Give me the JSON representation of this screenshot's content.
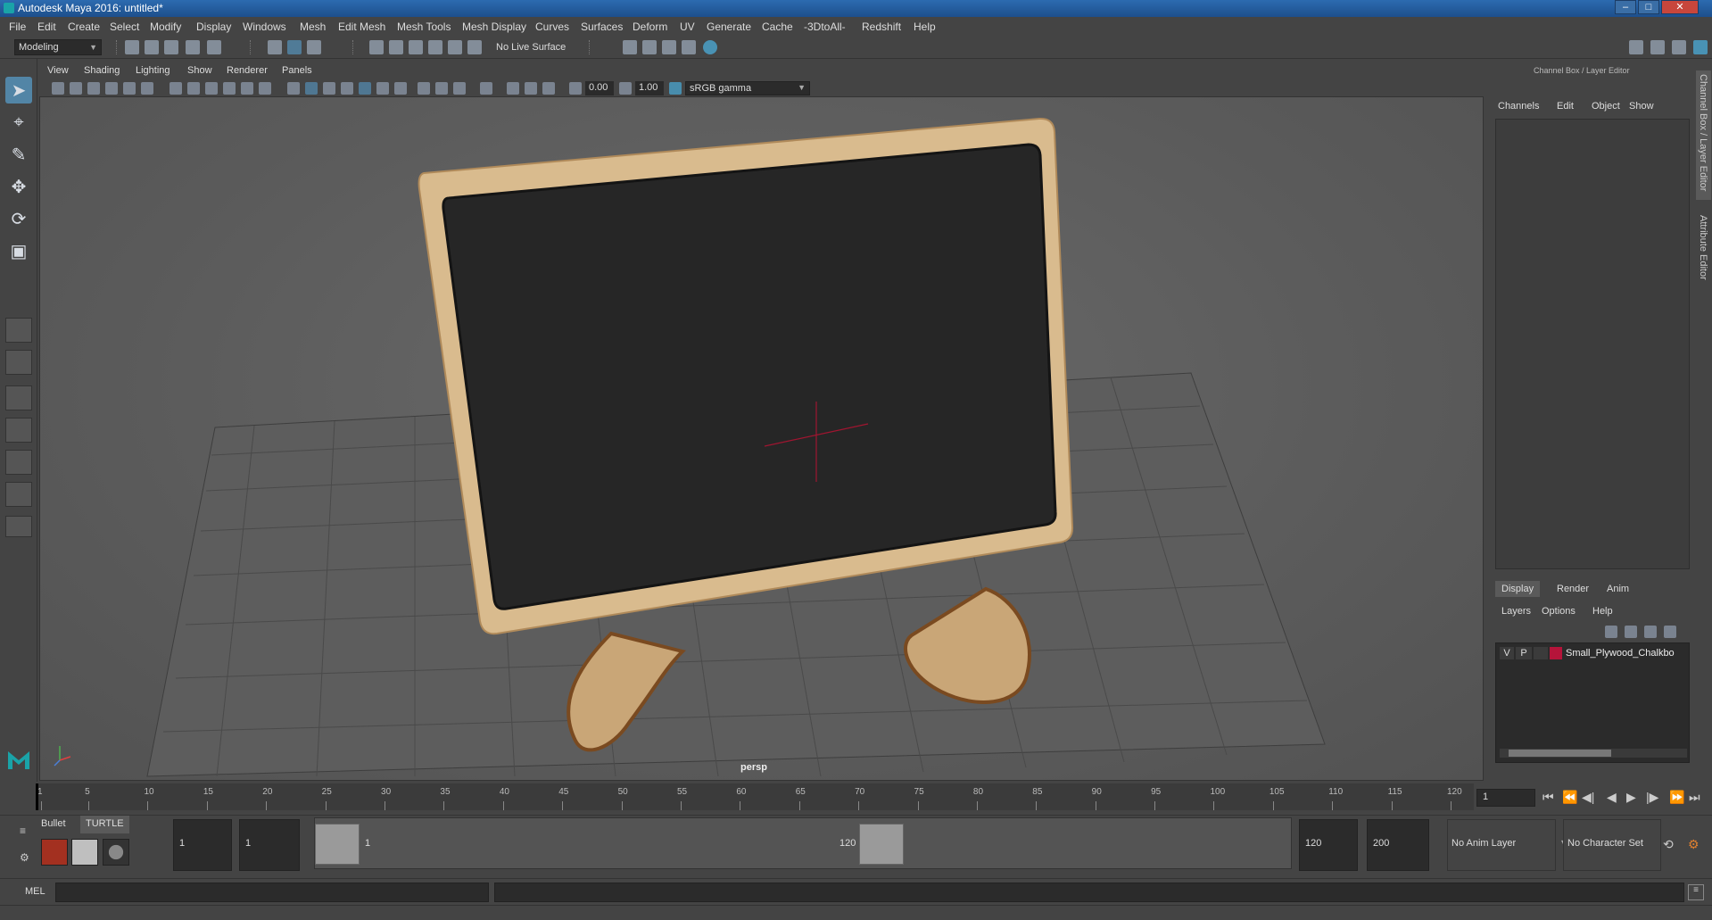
{
  "window": {
    "title": "Autodesk Maya 2016: untitled*"
  },
  "menubar": [
    "File",
    "Edit",
    "Create",
    "Select",
    "Modify",
    "Display",
    "Windows",
    "Mesh",
    "Edit Mesh",
    "Mesh Tools",
    "Mesh Display",
    "Curves",
    "Surfaces",
    "Deform",
    "UV",
    "Generate",
    "Cache",
    "-3DtoAll-",
    "Redshift",
    "Help"
  ],
  "toolbar": {
    "mode": "Modeling",
    "live_surface": "No Live Surface"
  },
  "viewport": {
    "menu": [
      "View",
      "Shading",
      "Lighting",
      "Show",
      "Renderer",
      "Panels"
    ],
    "field_a": "0.00",
    "field_b": "1.00",
    "color_space": "sRGB gamma",
    "camera_label": "persp"
  },
  "right_panel": {
    "header": "Channel Box / Layer Editor",
    "channel_tabs": [
      "Channels",
      "Edit",
      "Object",
      "Show"
    ],
    "layer_tabs": [
      "Display",
      "Render",
      "Anim"
    ],
    "layer_menu": [
      "Layers",
      "Options",
      "Help"
    ],
    "layer": {
      "v": "V",
      "p": "P",
      "name": "Small_Plywood_Chalkbo",
      "color": "#b5143a"
    },
    "side_tabs": [
      "Channel Box / Layer Editor",
      "Attribute Editor"
    ]
  },
  "timeline": {
    "ticks": [
      1,
      5,
      10,
      15,
      20,
      25,
      30,
      35,
      40,
      45,
      50,
      55,
      60,
      65,
      70,
      75,
      80,
      85,
      90,
      95,
      100,
      105,
      110,
      115,
      120
    ],
    "current_frame": "1"
  },
  "range": {
    "start": "1",
    "anim_start": "1",
    "slider_start": "1",
    "slider_end": "120",
    "anim_end": "120",
    "end": "200",
    "anim_layer": "No Anim Layer",
    "character_set": "No Character Set"
  },
  "shelf": {
    "tabs": [
      "Bullet",
      "TURTLE"
    ]
  },
  "command": {
    "label": "MEL"
  }
}
